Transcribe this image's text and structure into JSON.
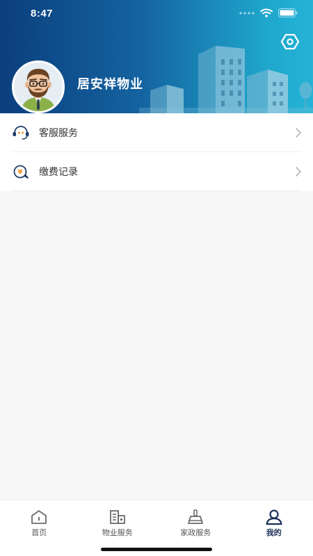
{
  "status_bar": {
    "time": "8:47"
  },
  "header": {
    "profile_name": "居安祥物业"
  },
  "menu": {
    "items": [
      {
        "label": "客服服务",
        "icon": "headset-icon"
      },
      {
        "label": "缴费记录",
        "icon": "payment-record-icon"
      }
    ]
  },
  "tabbar": {
    "items": [
      {
        "label": "首页",
        "icon": "home-icon",
        "active": false
      },
      {
        "label": "物业服务",
        "icon": "building-icon",
        "active": false
      },
      {
        "label": "家政服务",
        "icon": "broom-icon",
        "active": false
      },
      {
        "label": "我的",
        "icon": "user-icon",
        "active": true
      }
    ]
  },
  "colors": {
    "header_start": "#0b3f7e",
    "header_end": "#25b3d6",
    "active_tab": "#1b2f5a",
    "accent_orange": "#f08c1a"
  }
}
